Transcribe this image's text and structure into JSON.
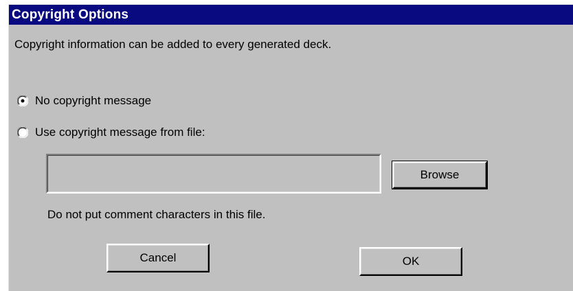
{
  "window": {
    "title": "Copyright Options"
  },
  "info": {
    "text": "Copyright information can be added to every generated deck."
  },
  "options": {
    "no_message_label": "No copyright message",
    "from_file_label": "Use copyright message from file:",
    "selected": "no_message"
  },
  "file_input": {
    "value": "",
    "placeholder": ""
  },
  "buttons": {
    "browse_label": "Browse",
    "cancel_label": "Cancel",
    "ok_label": "OK"
  },
  "note": {
    "text": "Do not put comment characters in this file."
  },
  "icons": {
    "radio_selected": "radio-selected-icon",
    "radio_unselected": "radio-unselected-icon"
  },
  "colors": {
    "title_bar": "#0a0a80",
    "title_text": "#ffffff",
    "dialog_face": "#c0c0c0"
  }
}
